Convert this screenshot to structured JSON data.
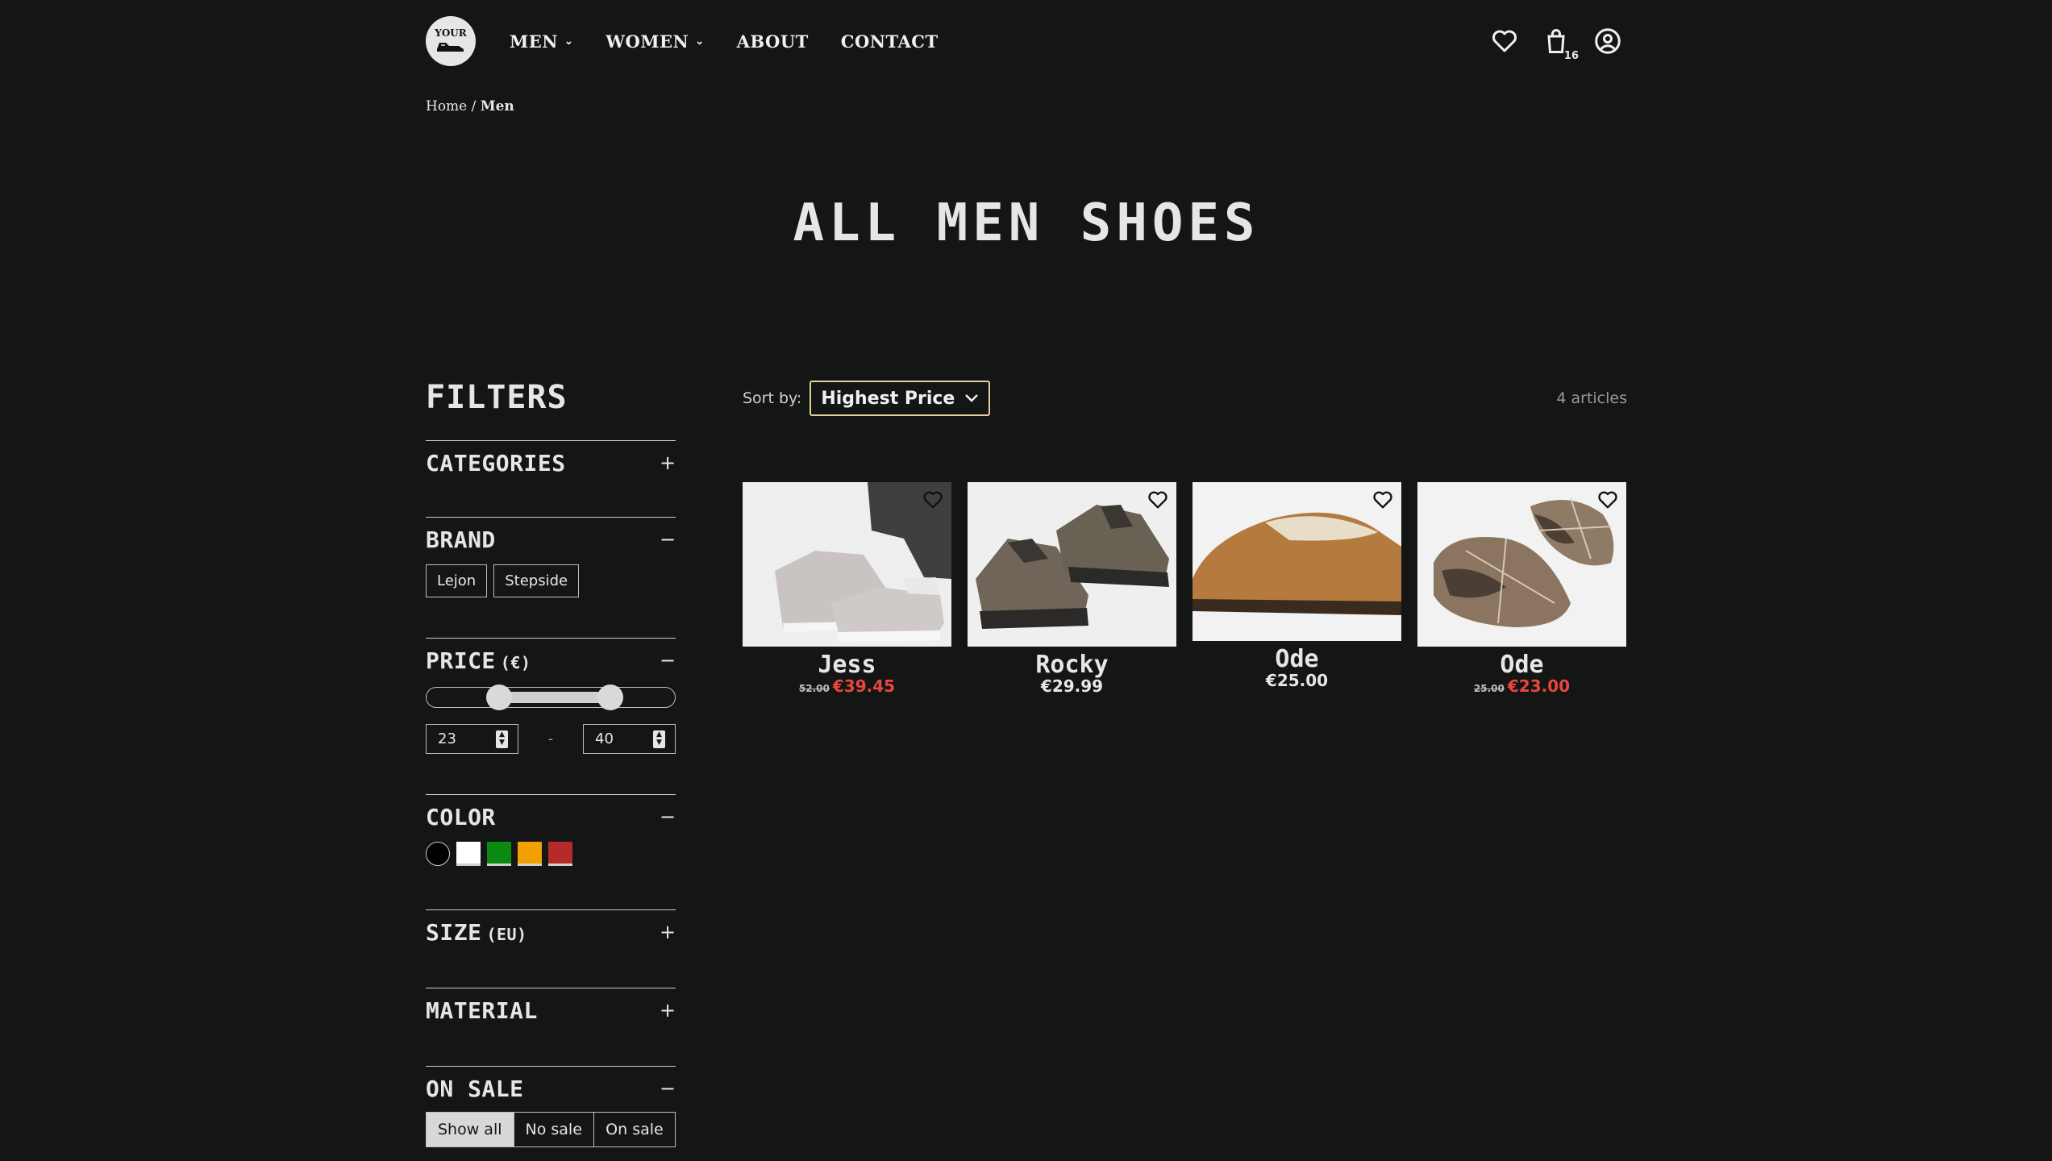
{
  "header": {
    "logo_text": "YOUR",
    "nav": [
      {
        "label": "MEN",
        "has_dropdown": true
      },
      {
        "label": "WOMEN",
        "has_dropdown": true
      },
      {
        "label": "ABOUT",
        "has_dropdown": false
      },
      {
        "label": "CONTACT",
        "has_dropdown": false
      }
    ],
    "cart_count": "16",
    "icons": [
      "heart-icon",
      "shopping-bag-icon",
      "user-account-icon"
    ]
  },
  "breadcrumb": {
    "home": "Home",
    "separator": "/",
    "current": "Men"
  },
  "page_title": "ALL MEN SHOES",
  "filters": {
    "title": "FILTERS",
    "sections": {
      "categories": {
        "label": "CATEGORIES",
        "toggle": "+"
      },
      "brand": {
        "label": "BRAND",
        "toggle": "−",
        "options": [
          "Lejon",
          "Stepside"
        ]
      },
      "price": {
        "label": "PRICE",
        "unit": "(€)",
        "toggle": "−",
        "min": "23",
        "max": "40",
        "separator": "-"
      },
      "color": {
        "label": "COLOR",
        "toggle": "−",
        "swatches": [
          "#000000",
          "#ffffff",
          "#0a8a10",
          "#f0a000",
          "#b62a2a"
        ]
      },
      "size": {
        "label": "SIZE",
        "unit": "(EU)",
        "toggle": "+"
      },
      "material": {
        "label": "MATERIAL",
        "toggle": "+"
      },
      "on_sale": {
        "label": "ON SALE",
        "toggle": "−",
        "options": [
          "Show all",
          "No sale",
          "On sale"
        ],
        "selected": "Show all"
      }
    }
  },
  "toolbar": {
    "sort_label": "Sort by:",
    "sort_value": "Highest Price",
    "count": "4 articles"
  },
  "products": [
    {
      "name": "Jess",
      "old_price": "52.00",
      "price": "€39.45",
      "on_sale": true
    },
    {
      "name": "Rocky",
      "price": "€29.99",
      "on_sale": false
    },
    {
      "name": "Ode",
      "price": "€25.00",
      "on_sale": false
    },
    {
      "name": "Ode",
      "old_price": "25.00",
      "price": "€23.00",
      "on_sale": true
    }
  ],
  "colors": {
    "background": "#141515",
    "text": "#e6e6e6",
    "sale": "#e8473c",
    "sort_border": "#e7cf99"
  }
}
